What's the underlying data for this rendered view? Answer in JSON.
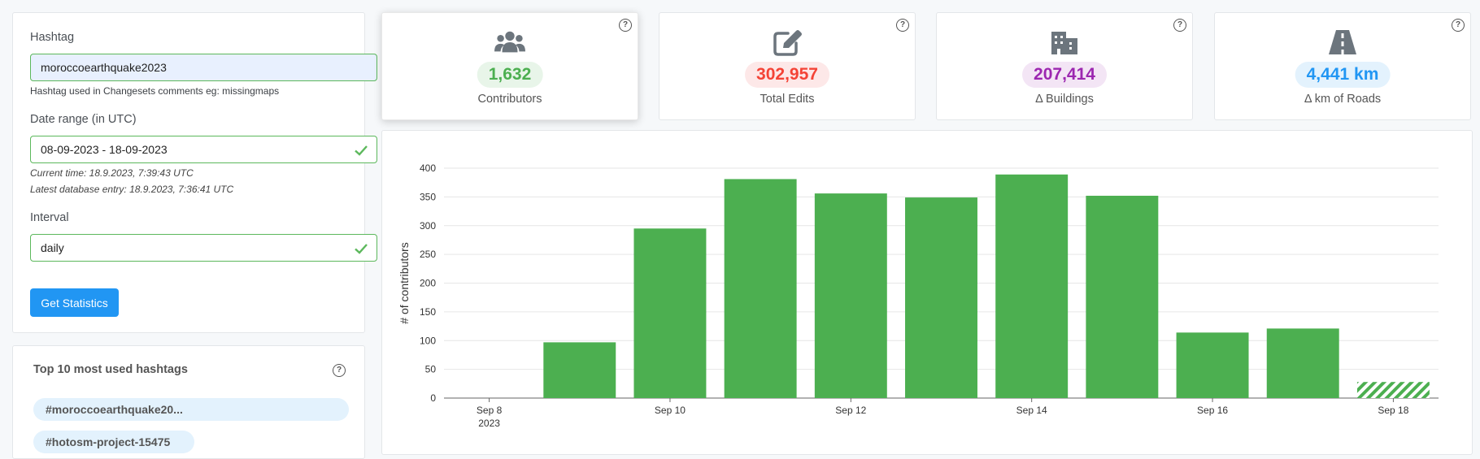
{
  "form": {
    "hashtag_label": "Hashtag",
    "hashtag_value": "moroccoearthquake2023",
    "hashtag_help": "Hashtag used in Changesets comments eg: missingmaps",
    "date_label": "Date range (in UTC)",
    "date_value": "08-09-2023 - 18-09-2023",
    "current_time": "Current time: 18.9.2023, 7:39:43 UTC",
    "latest_entry": "Latest database entry: 18.9.2023, 7:36:41 UTC",
    "interval_label": "Interval",
    "interval_value": "daily",
    "submit_label": "Get Statistics"
  },
  "hashtags": {
    "title": "Top 10 most used hashtags",
    "help": "?",
    "items": [
      "#moroccoearthquake20...",
      "#hotosm-project-15475"
    ]
  },
  "stats": [
    {
      "label": "Contributors",
      "value": "1,632",
      "icon": "users-icon",
      "color": "#4caf50",
      "bg": "#e8f5e9"
    },
    {
      "label": "Total Edits",
      "value": "302,957",
      "icon": "edit-icon",
      "color": "#f44336",
      "bg": "#fde8e8"
    },
    {
      "label": "Δ Buildings",
      "value": "207,414",
      "icon": "buildings-icon",
      "color": "#9c27b0",
      "bg": "#f3e5f5"
    },
    {
      "label": "Δ km of Roads",
      "value": "4,441 km",
      "icon": "road-icon",
      "color": "#2196f3",
      "bg": "#e3f2fd"
    }
  ],
  "chart_data": {
    "type": "bar",
    "ylabel": "# of contributors",
    "ylim": [
      0,
      400
    ],
    "yticks": [
      0,
      50,
      100,
      150,
      200,
      250,
      300,
      350,
      400
    ],
    "categories": [
      "Sep 8 2023",
      "Sep 9",
      "Sep 10",
      "Sep 11",
      "Sep 12",
      "Sep 13",
      "Sep 14",
      "Sep 15",
      "Sep 16",
      "Sep 17",
      "Sep 18"
    ],
    "values": [
      0,
      97,
      295,
      381,
      356,
      349,
      389,
      352,
      114,
      121,
      28
    ],
    "xtick_labels": [
      {
        "index": 0,
        "line1": "Sep 8",
        "line2": "2023"
      },
      {
        "index": 2,
        "line1": "Sep 10",
        "line2": ""
      },
      {
        "index": 4,
        "line1": "Sep 12",
        "line2": ""
      },
      {
        "index": 6,
        "line1": "Sep 14",
        "line2": ""
      },
      {
        "index": 8,
        "line1": "Sep 16",
        "line2": ""
      },
      {
        "index": 10,
        "line1": "Sep 18",
        "line2": ""
      }
    ],
    "partial_last_bar": true,
    "bar_color": "#4caf50",
    "grid": true
  }
}
